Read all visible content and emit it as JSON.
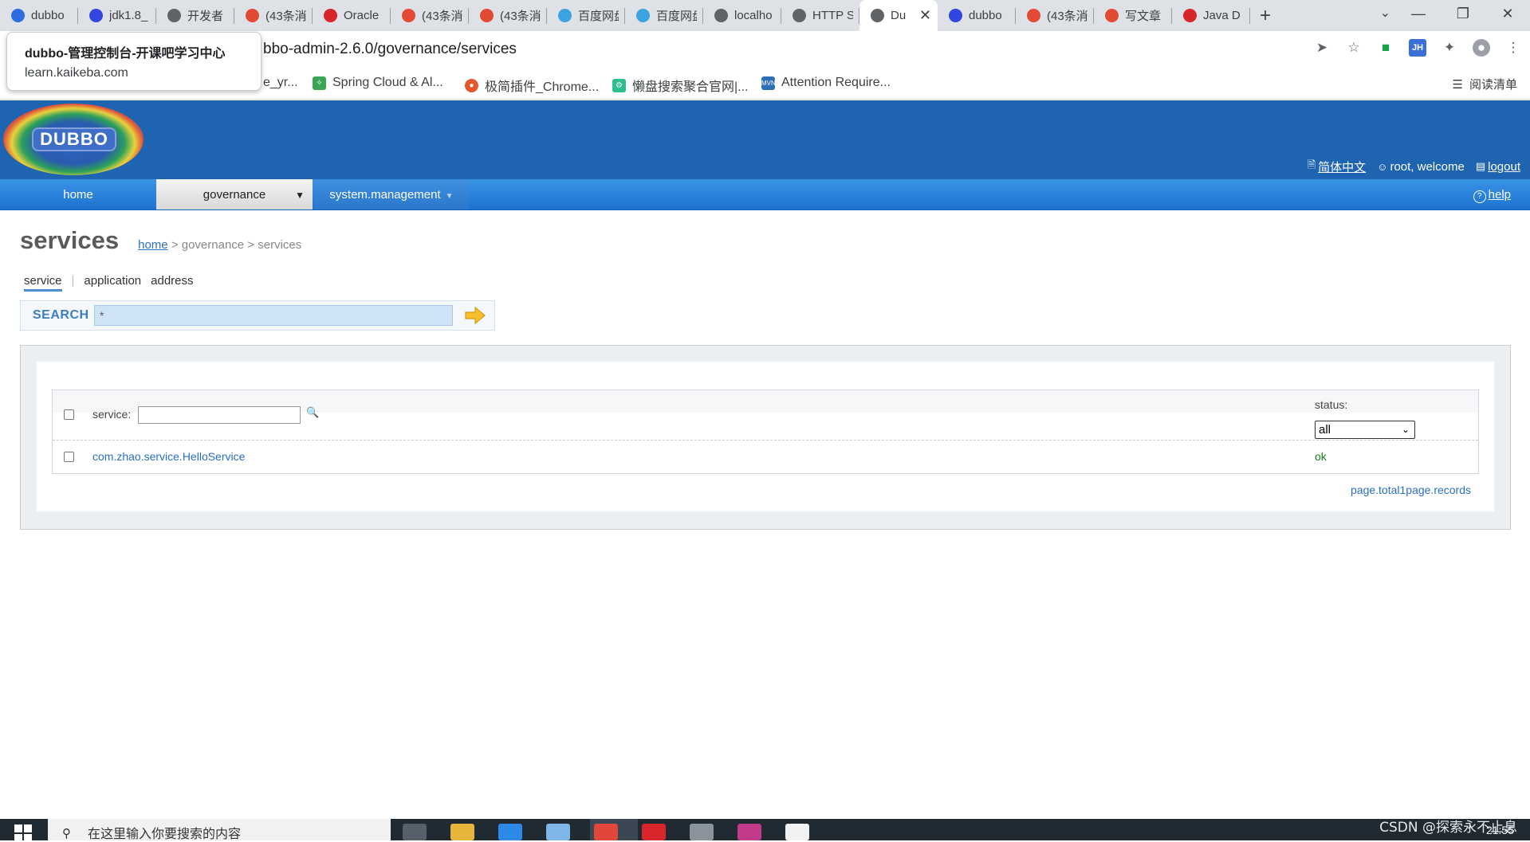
{
  "browser": {
    "tabs": [
      {
        "title": "dubbo",
        "icon": "kaikeba-icon",
        "color": "#2b6de0",
        "active": false
      },
      {
        "title": "jdk1.8_",
        "icon": "baidu-icon",
        "color": "#3245df",
        "active": false
      },
      {
        "title": "开发者",
        "icon": "globe-icon",
        "color": "#5f6368",
        "active": false
      },
      {
        "title": "(43条消",
        "icon": "csdn-icon",
        "color": "#e34a36",
        "active": false
      },
      {
        "title": "Oracle",
        "icon": "oracle-icon",
        "color": "#d7262b",
        "active": false
      },
      {
        "title": "(43条消",
        "icon": "csdn-icon",
        "color": "#e34a36",
        "active": false
      },
      {
        "title": "(43条消",
        "icon": "csdn-icon",
        "color": "#e34a36",
        "active": false
      },
      {
        "title": "百度网盘",
        "icon": "baidu-pan-icon",
        "color": "#3ba3e0",
        "active": false
      },
      {
        "title": "百度网盘",
        "icon": "baidu-pan-icon",
        "color": "#3ba3e0",
        "active": false
      },
      {
        "title": "localho",
        "icon": "globe-icon",
        "color": "#5f6368",
        "active": false
      },
      {
        "title": "HTTP S",
        "icon": "globe-icon",
        "color": "#5f6368",
        "active": false
      },
      {
        "title": "Du",
        "icon": "globe-icon",
        "color": "#5f6368",
        "active": true
      },
      {
        "title": "dubbo",
        "icon": "baidu-icon",
        "color": "#3245df",
        "active": false
      },
      {
        "title": "(43条消",
        "icon": "csdn-icon",
        "color": "#e34a36",
        "active": false
      },
      {
        "title": "写文章",
        "icon": "csdn-icon",
        "color": "#e34a36",
        "active": false
      },
      {
        "title": "Java D",
        "icon": "oracle-icon",
        "color": "#d7262b",
        "active": false
      }
    ],
    "url": "bbo-admin-2.6.0/governance/services",
    "tooltip": {
      "title": "dubbo-管理控制台-开课吧学习中心",
      "domain": "learn.kaikeba.com"
    },
    "bookmarks": [
      {
        "label": "e_yr...",
        "icon": "bookmark-icon",
        "color": "#ffffff"
      },
      {
        "label": "Spring Cloud & Al...",
        "icon": "leaf-icon",
        "color": "#3aa655"
      },
      {
        "label": "极简插件_Chrome...",
        "icon": "chrome-icon",
        "color": "#e4572e"
      },
      {
        "label": "懒盘搜索聚合官网|...",
        "icon": "gear-icon",
        "color": "#2bbf8e"
      },
      {
        "label": "Attention Require...",
        "icon": "mvn-icon",
        "color": "#2f6fb8"
      }
    ],
    "reading_list": "阅读清单"
  },
  "header": {
    "logo_text": "DUBBO",
    "lang_link": "简体中文",
    "welcome": "root, welcome",
    "logout": "logout"
  },
  "nav": {
    "home": "home",
    "governance": "governance",
    "system": "system.management",
    "help": "help"
  },
  "page": {
    "title": "services",
    "breadcrumb": {
      "home": "home",
      "sep1": " > governance > services"
    },
    "subtabs": {
      "service": "service",
      "sep": "|",
      "application": "application",
      "address": "address"
    },
    "search": {
      "label": "SEARCH",
      "value": "*"
    }
  },
  "list": {
    "filter_label": "service:",
    "filter_value": "",
    "status_label": "status:",
    "status_value": "all",
    "rows": [
      {
        "service": "com.zhao.service.HelloService",
        "status": "ok"
      }
    ],
    "pagination": "page.total1page.records"
  },
  "taskbar": {
    "search_placeholder": "在这里输入你要搜索的内容",
    "tray_time": "21:55"
  },
  "watermark": "CSDN @探索永不止息"
}
